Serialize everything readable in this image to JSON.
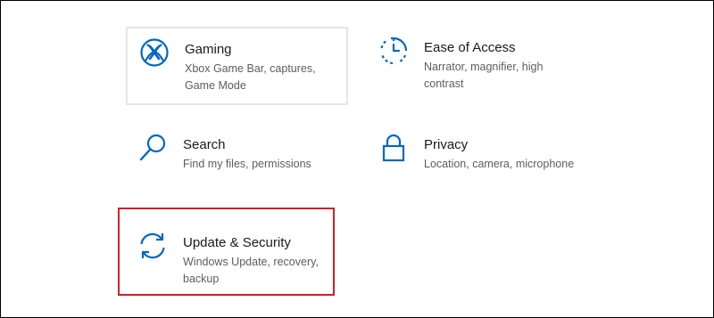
{
  "settings": {
    "tiles": [
      {
        "id": "gaming",
        "title": "Gaming",
        "description": "Xbox Game Bar, captures, Game Mode",
        "icon": "xbox-icon"
      },
      {
        "id": "ease",
        "title": "Ease of Access",
        "description": "Narrator, magnifier, high contrast",
        "icon": "ease-of-access-icon"
      },
      {
        "id": "search",
        "title": "Search",
        "description": "Find my files, permissions",
        "icon": "search-icon"
      },
      {
        "id": "privacy",
        "title": "Privacy",
        "description": "Location, camera, microphone",
        "icon": "lock-icon"
      },
      {
        "id": "update",
        "title": "Update & Security",
        "description": "Windows Update, recovery, backup",
        "icon": "sync-icon"
      }
    ]
  },
  "colors": {
    "accent": "#0067c0",
    "highlight": "#d0202a",
    "hover_border": "#e6e6e6",
    "title_text": "#1a1a1a",
    "description_text": "#5d5d5d"
  }
}
